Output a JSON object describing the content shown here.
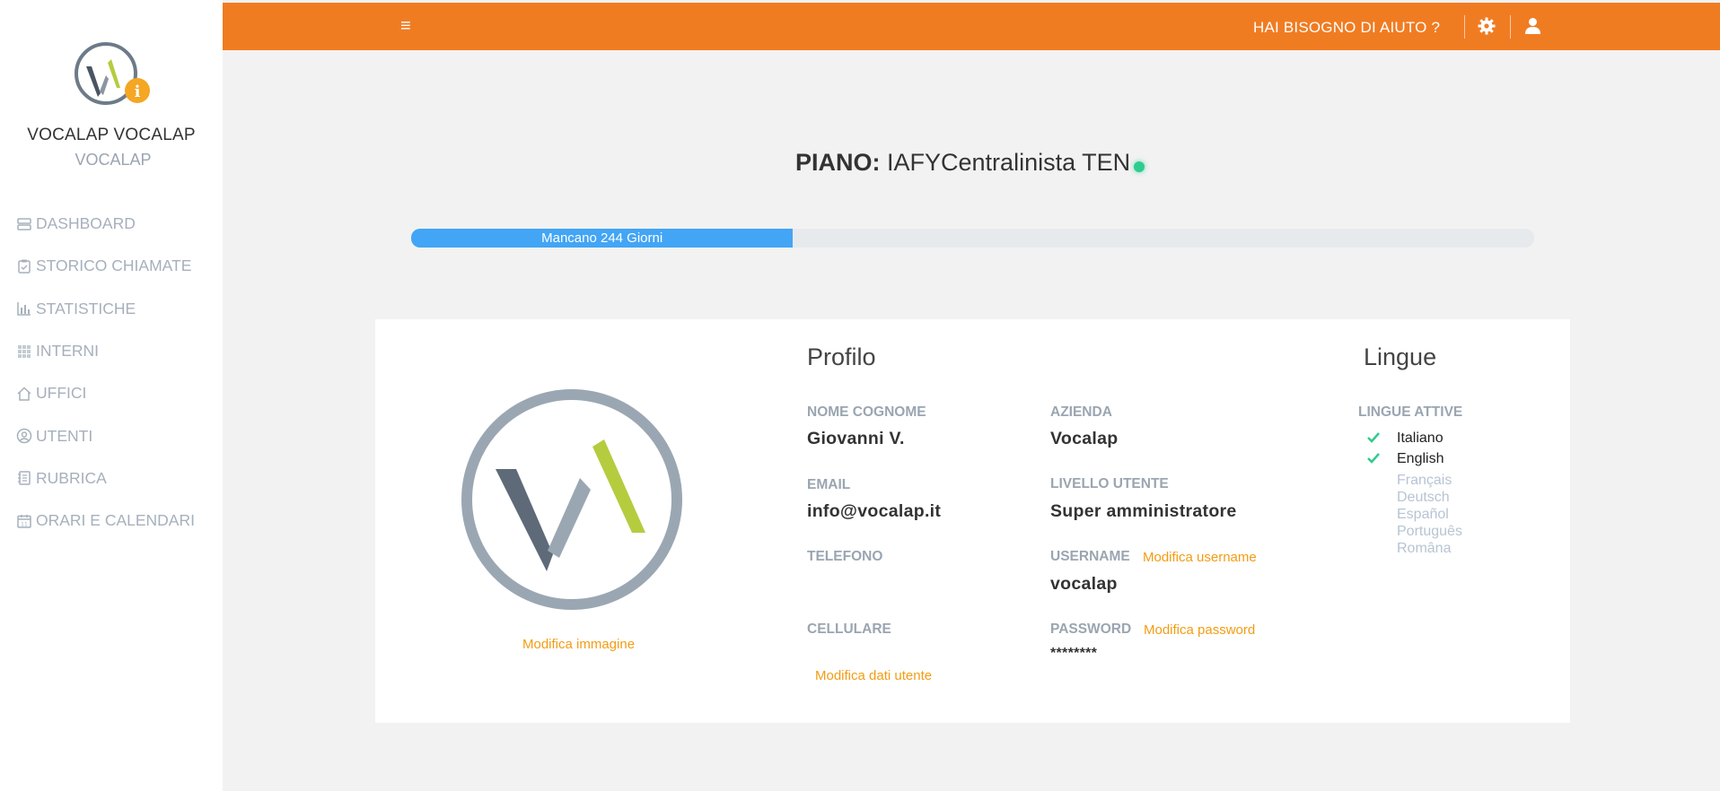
{
  "brand": {
    "name": "VOCALAP VOCALAP",
    "sub": "VOCALAP"
  },
  "nav": [
    {
      "label": "DASHBOARD",
      "icon": "dashboard-icon"
    },
    {
      "label": "STORICO CHIAMATE",
      "icon": "clipboard-icon"
    },
    {
      "label": "STATISTICHE",
      "icon": "bar-chart-icon"
    },
    {
      "label": "INTERNI",
      "icon": "grid-icon"
    },
    {
      "label": "UFFICI",
      "icon": "home-icon"
    },
    {
      "label": "UTENTI",
      "icon": "user-circle-icon"
    },
    {
      "label": "RUBRICA",
      "icon": "address-book-icon"
    },
    {
      "label": "ORARI E CALENDARI",
      "icon": "calendar-icon"
    }
  ],
  "topbar": {
    "help": "HAI BISOGNO DI AIUTO ?"
  },
  "plan": {
    "label": "PIANO:",
    "name": "IAFYCentralinista TEN",
    "remaining_text": "Mancano 244 Giorni",
    "progress_pct": 34
  },
  "profile": {
    "title": "Profilo",
    "edit_image": "Modifica immagine",
    "name_label": "NOME COGNOME",
    "name_value": "Giovanni  V.",
    "company_label": "AZIENDA",
    "company_value": "Vocalap",
    "email_label": "EMAIL",
    "email_value": "info@vocalap.it",
    "level_label": "LIVELLO UTENTE",
    "level_value": "Super amministratore",
    "phone_label": "TELEFONO",
    "username_label": "USERNAME",
    "edit_username": "Modifica username",
    "username_value": "vocalap",
    "mobile_label": "CELLULARE",
    "password_label": "PASSWORD",
    "edit_password": "Modifica password",
    "password_value": "********",
    "edit_data": "Modifica dati utente"
  },
  "languages": {
    "title": "Lingue",
    "active_label": "LINGUE ATTIVE",
    "active": [
      "Italiano",
      "English"
    ],
    "inactive": [
      "Français",
      "Deutsch",
      "Español",
      "Português",
      "Româna"
    ]
  },
  "colors": {
    "accent": "#f07c22",
    "progress": "#42a5f5",
    "link": "#f39c12",
    "status": "#2ecc8f"
  }
}
